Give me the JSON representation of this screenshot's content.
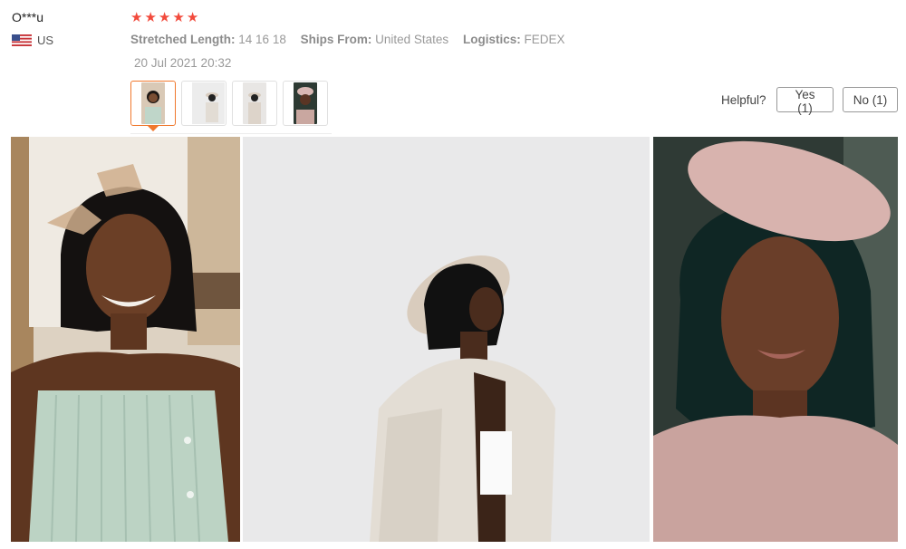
{
  "reviewer": {
    "name": "O***u",
    "country": "US"
  },
  "rating": {
    "stars": 5,
    "max": 5
  },
  "attributes": [
    {
      "label": "Stretched Length:",
      "value": "14 16 18"
    },
    {
      "label": "Ships From:",
      "value": "United States"
    },
    {
      "label": "Logistics:",
      "value": "FEDEX"
    }
  ],
  "date": "20 Jul 2021 20:32",
  "helpful": {
    "label": "Helpful?",
    "yes": "Yes (1)",
    "no": "No (1)"
  },
  "colors": {
    "star": "#f24a3c",
    "active_thumb": "#f0782d"
  }
}
